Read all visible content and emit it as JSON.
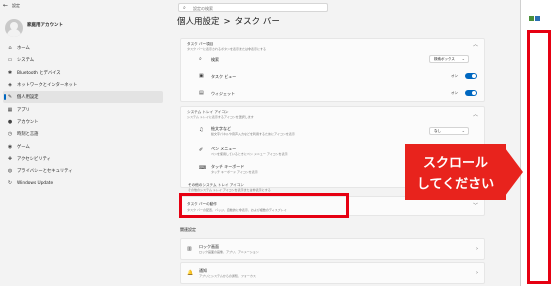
{
  "window": {
    "back": "←",
    "title": "設定"
  },
  "search": {
    "placeholder": "設定の検索"
  },
  "user": {
    "name": "家庭用アカウント"
  },
  "sidebar": {
    "items": [
      {
        "icon": "⌂",
        "label": "ホーム"
      },
      {
        "icon": "▭",
        "label": "システム"
      },
      {
        "icon": "✱",
        "label": "Bluetooth とデバイス"
      },
      {
        "icon": "◈",
        "label": "ネットワークとインターネット"
      },
      {
        "icon": "✎",
        "label": "個人用設定",
        "active": true
      },
      {
        "icon": "▦",
        "label": "アプリ"
      },
      {
        "icon": "●",
        "label": "アカウント"
      },
      {
        "icon": "◷",
        "label": "時刻と言語"
      },
      {
        "icon": "◉",
        "label": "ゲーム"
      },
      {
        "icon": "✚",
        "label": "アクセシビリティ"
      },
      {
        "icon": "◍",
        "label": "プライバシーとセキュリティ"
      },
      {
        "icon": "↻",
        "label": "Windows Update"
      }
    ]
  },
  "breadcrumb": {
    "parent": "個人用設定",
    "separator": ">",
    "current": "タスク バー"
  },
  "taskbar_items": {
    "title": "タスク バー項目",
    "subtitle": "タスク バーに表示されるボタンを表示または非表示にする",
    "rows": [
      {
        "icon": "⌕",
        "label": "検索",
        "control": "dropdown",
        "value": "検索ボックス"
      },
      {
        "icon": "▣",
        "label": "タスク ビュー",
        "control": "toggle",
        "value": "オン"
      },
      {
        "icon": "▤",
        "label": "ウィジェット",
        "control": "toggle",
        "value": "オン"
      }
    ]
  },
  "system_tray": {
    "title": "システム トレイ アイコン",
    "subtitle": "システム トレイに表示するアイコンを選択します",
    "rows": [
      {
        "icon": "♫",
        "label": "絵文字など",
        "sub": "絵文字パネルや音声入力などを利用するためにアイコンを表示",
        "control": "dropdown",
        "value": "なし"
      },
      {
        "icon": "✐",
        "label": "ペン メニュー",
        "sub": "ペンを使用しているときにペン メニュー アイコンを表示"
      },
      {
        "icon": "⌨",
        "label": "タッチ キーボード",
        "sub": "タッチ キーボード アイコンを表示"
      }
    ]
  },
  "other_tray": {
    "title": "その他のシステム トレイ アイコン",
    "subtitle": "その他のシステム トレイ アイコンを表示または非表示にする"
  },
  "taskbar_behavior": {
    "title": "タスク バーの動作",
    "subtitle": "タスク バーの配置、バッジ、自動的に非表示、および複数のディスプレイ"
  },
  "related": {
    "heading": "関連設定",
    "items": [
      {
        "icon": "▥",
        "label": "ロック画面",
        "sub": "ロック画面の画像、アプリ、アニメーション"
      },
      {
        "icon": "🔔",
        "label": "通知",
        "sub": "アプリとシステムからの通知、フォーカス"
      }
    ]
  },
  "callout": {
    "line1": "スクロール",
    "line2": "してください"
  },
  "colors": {
    "accent": "#0067c0",
    "highlight_red": "#e60012",
    "callout_red": "#e8231d"
  }
}
